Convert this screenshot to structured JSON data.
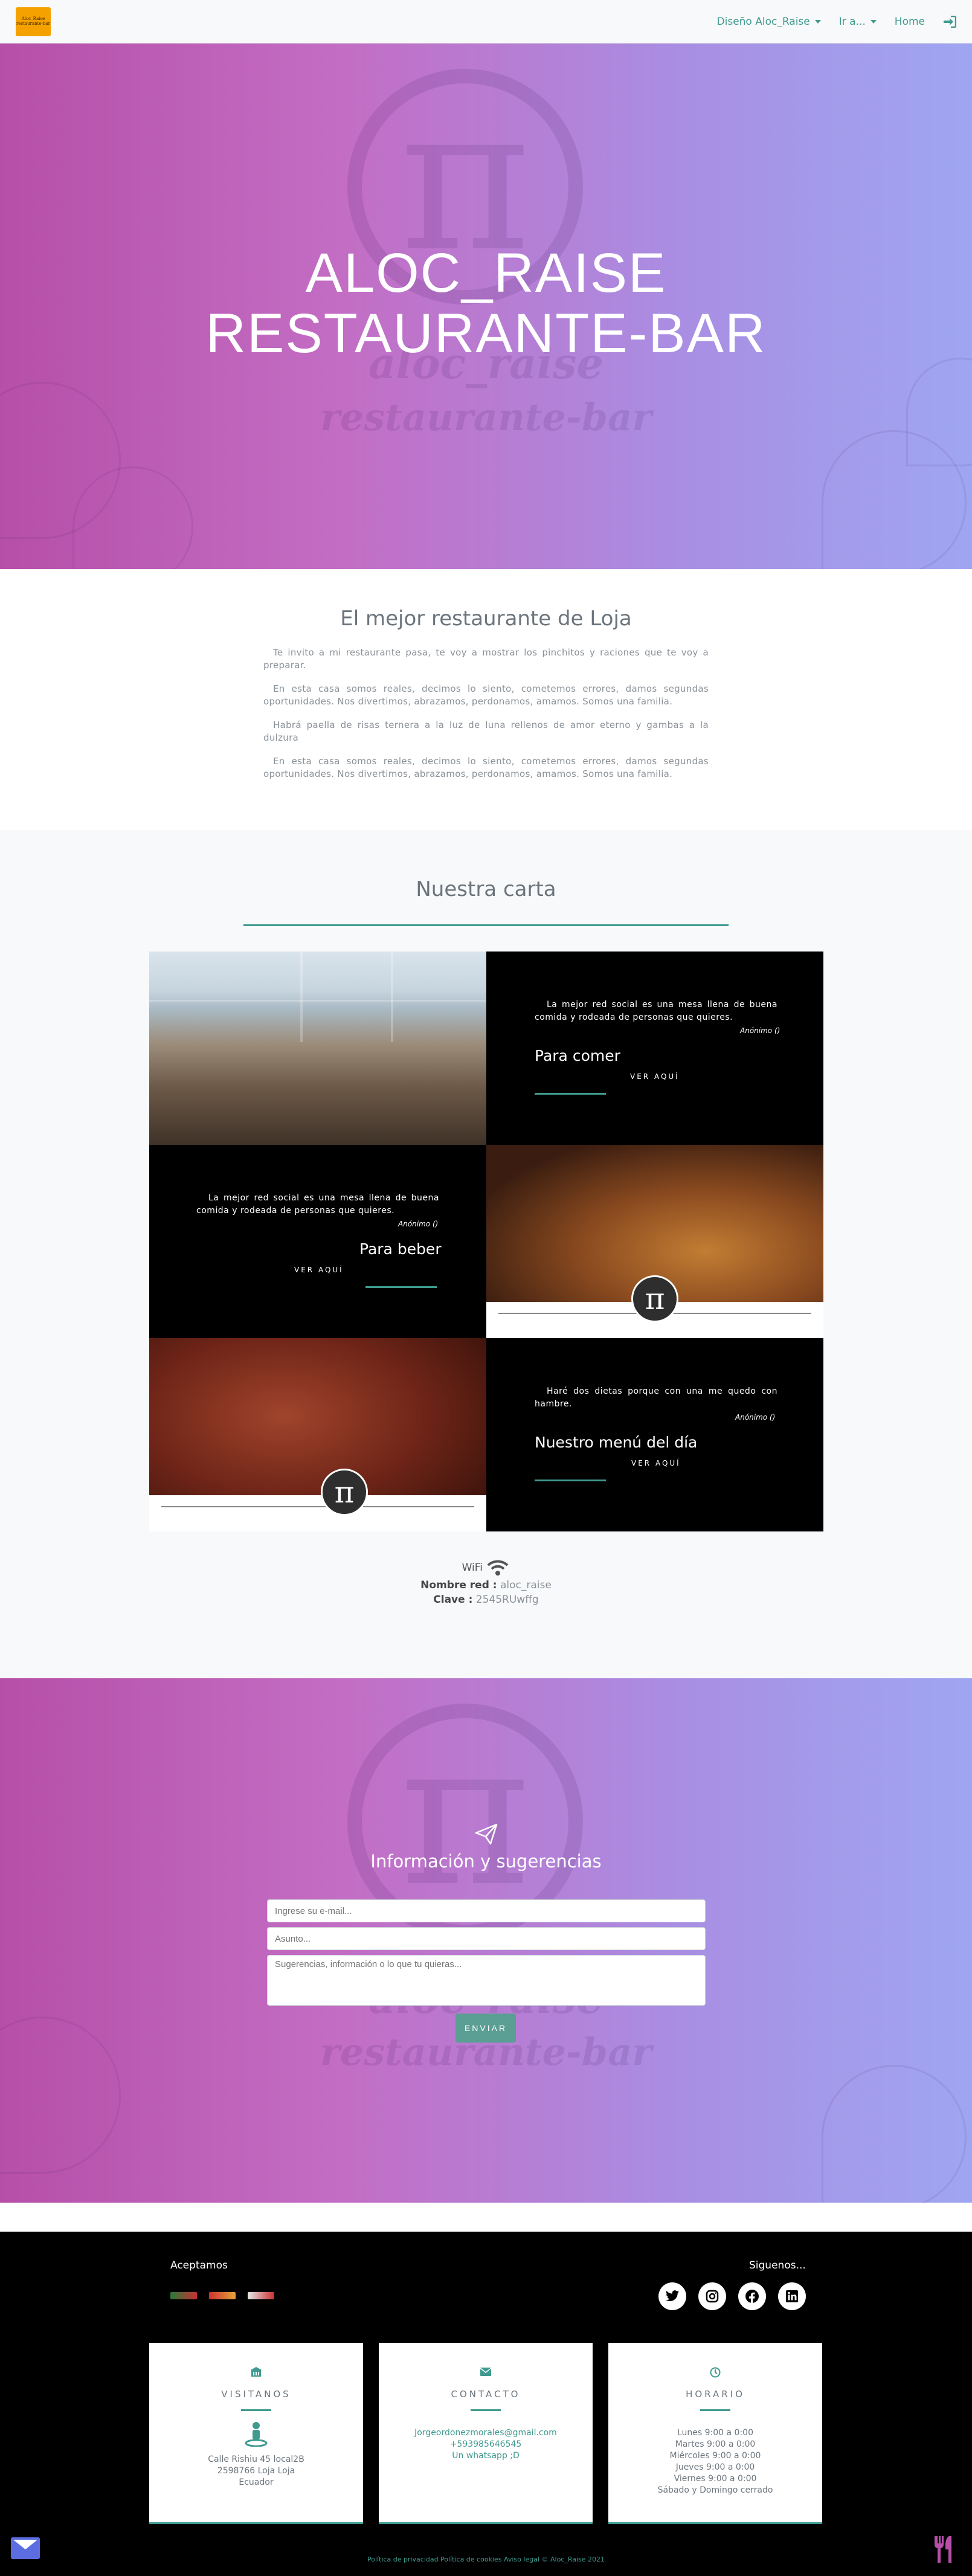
{
  "navbar": {
    "logo_text": "Aloc_Raise restaurante-bar",
    "menu_disenio": "Diseño Aloc_Raise",
    "menu_ir": "Ir a...",
    "home": "Home"
  },
  "hero": {
    "title_line1": "ALOC_RAISE",
    "title_line2": "RESTAURANTE-BAR",
    "bg_brand": "aloc_raise",
    "bg_sub": "restaurante-bar"
  },
  "about": {
    "heading": "El mejor restaurante de Loja",
    "paragraphs": [
      "Te invito a mi restaurante pasa, te voy a mostrar los pinchitos y raciones que te voy a preparar.",
      "En esta casa somos reales, decimos lo siento, cometemos errores, damos segundas oportunidades. Nos divertimos, abrazamos, perdonamos, amamos. Somos una familia.",
      "Habrá paella de risas ternera a la luz de luna rellenos de amor eterno y gambas a la dulzura",
      "En esta casa somos reales, decimos lo siento, cometemos errores, damos segundas oportunidades. Nos divertimos, abrazamos, perdonamos, amamos. Somos una familia."
    ]
  },
  "menu": {
    "heading": "Nuestra carta",
    "items": [
      {
        "quote": "La mejor red social es una mesa llena de buena comida y rodeada de personas que quieres.",
        "author": "Anónimo ()",
        "title": "Para comer",
        "link": "VER AQUÍ"
      },
      {
        "quote": "La mejor red social es una mesa llena de buena comida y rodeada de personas que quieres.",
        "author": "Anónimo ()",
        "title": "Para beber",
        "link": "VER AQUÍ"
      },
      {
        "quote": "Haré dos dietas porque con una me quedo con hambre.",
        "author": "Anónimo ()",
        "title": "Nuestro menú del día",
        "link": "VER AQUÍ"
      }
    ],
    "pi_symbol": "π"
  },
  "wifi": {
    "label": "WiFi",
    "network_label": "Nombre red :",
    "network_value": "aloc_raise",
    "password_label": "Clave :",
    "password_value": "2545RUwffg"
  },
  "contact": {
    "heading": "Información y sugerencias",
    "email_placeholder": "Ingrese su e-mail...",
    "subject_placeholder": "Asunto...",
    "message_placeholder": "Sugerencias, información o lo que tu quieras...",
    "send_label": "ENVIAR"
  },
  "footer": {
    "accept_label": "Aceptamos",
    "follow_label": "Siguenos...",
    "social": [
      "twitter-icon",
      "instagram-icon",
      "facebook-icon",
      "linkedin-icon"
    ],
    "visit": {
      "title": "VISITANOS",
      "lines": [
        "Calle Rishiu 45 local2B",
        "2598766 Loja Loja",
        "Ecuador"
      ]
    },
    "contact": {
      "title": "CONTACTO",
      "email": "Jorgeordonezmorales@gmail.com",
      "phone": "+593985646545",
      "whatsapp": "Un whatsapp ;D"
    },
    "hours": {
      "title": "HORARIO",
      "lines": [
        "Lunes 9:00 a 0:00",
        "Martes 9:00 a 0:00",
        "Miércoles 9:00 a 0:00",
        "Jueves 9:00 a 0:00",
        "Viernes 9:00 a 0:00",
        "Sábado y Domingo cerrado"
      ]
    },
    "copyright": "Política de privacidad Política de cookies Aviso legal © Aloc_Raise 2021"
  },
  "colors": {
    "accent": "#3f9a8f",
    "gradient_start": "#b64fa8",
    "gradient_end": "#9fa6f1",
    "logo_bg": "#f5a100"
  }
}
